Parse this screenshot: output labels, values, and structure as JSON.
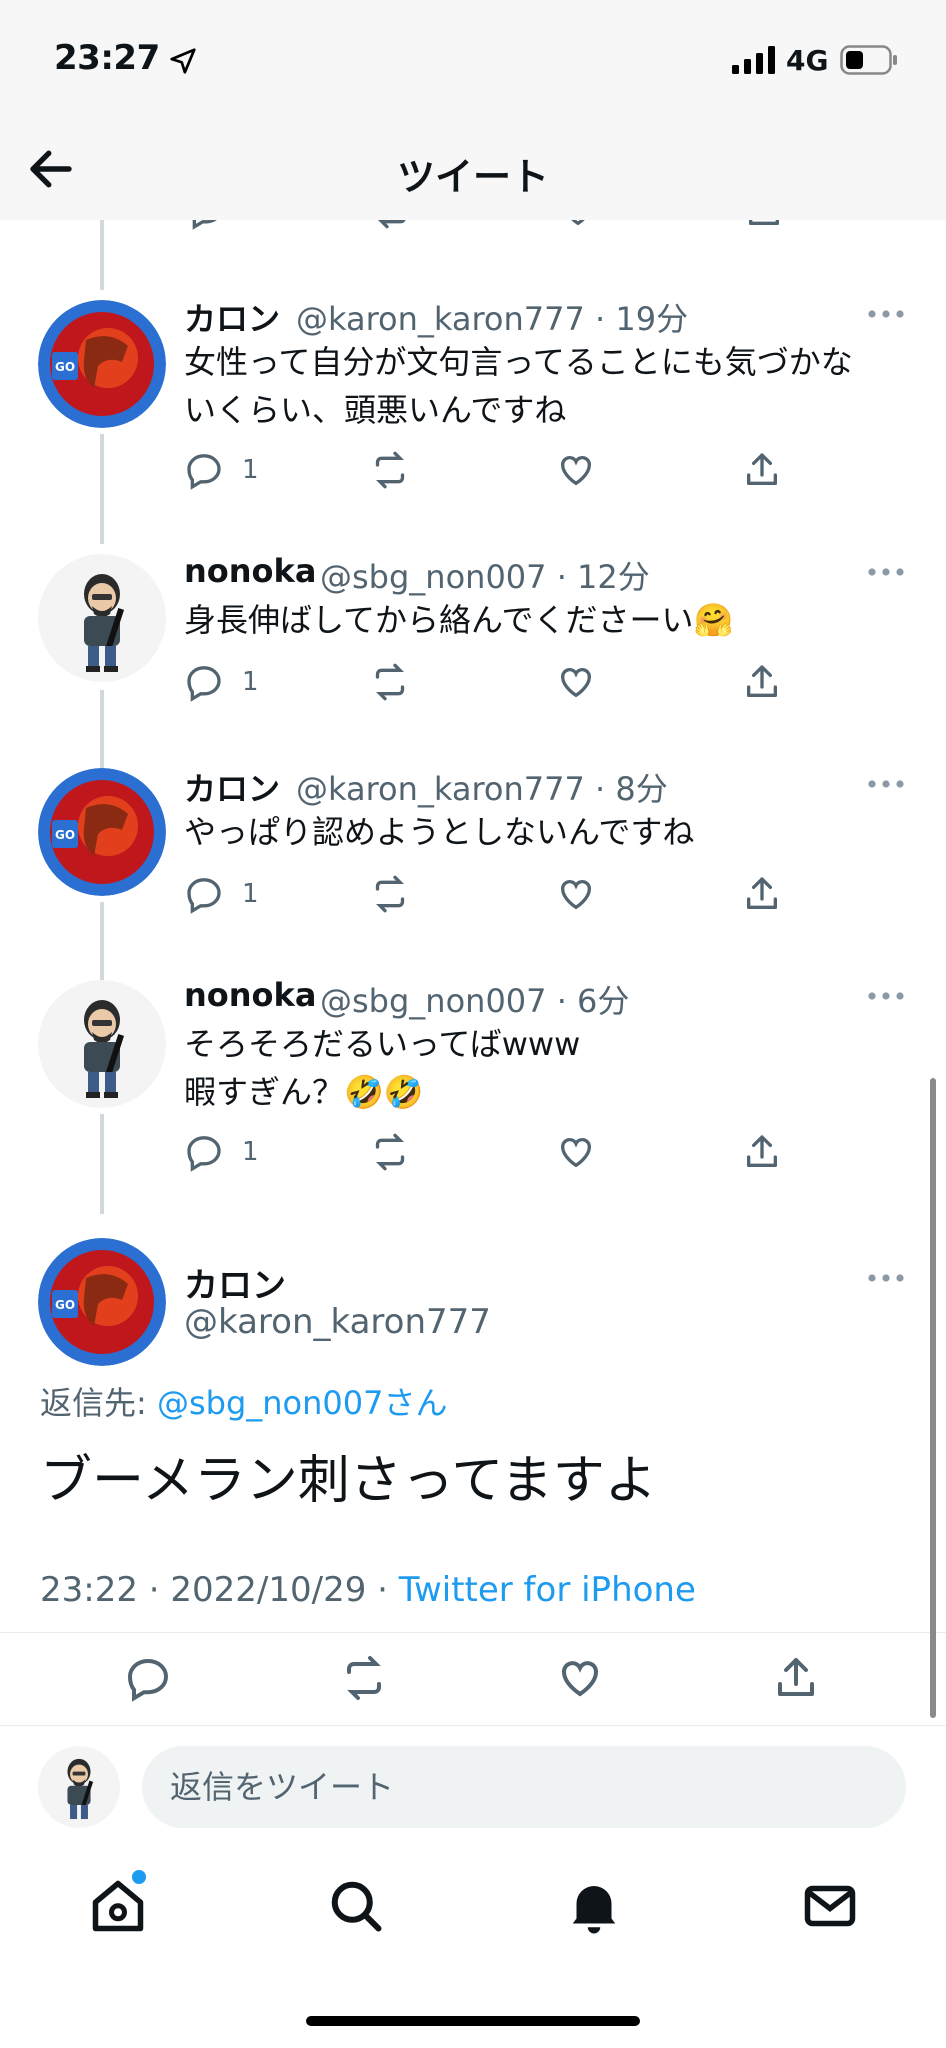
{
  "status_bar": {
    "time": "23:27",
    "network": "4G"
  },
  "header": {
    "title": "ツイート"
  },
  "replies": [
    {
      "name": "カロン",
      "handle": "@karon_karon777",
      "time": "19分",
      "text": "女性って自分が文句言ってることにも気づかな\nいくらい、頭悪いんですね",
      "reply_count": "1"
    },
    {
      "name": "nonoka",
      "handle": "@sbg_non007",
      "time": "12分",
      "text": "身長伸ばしてから絡んでくださーい🤗",
      "reply_count": "1"
    },
    {
      "name": "カロン",
      "handle": "@karon_karon777",
      "time": "8分",
      "text": "やっぱり認めようとしないんですね",
      "reply_count": "1"
    },
    {
      "name": "nonoka",
      "handle": "@sbg_non007",
      "time": "6分",
      "text": "そろそろだるいってばwww\n暇すぎん？🤣🤣",
      "reply_count": "1"
    }
  ],
  "main_tweet": {
    "name": "カロン",
    "handle": "@karon_karon777",
    "reply_to_label": "返信先:",
    "reply_to_handle": "@sbg_non007",
    "reply_to_suffix": "さん",
    "text": "ブーメラン刺さってますよ",
    "timestamp": "23:22 · 2022/10/29 · ",
    "source": "Twitter for iPhone"
  },
  "reply_box": {
    "placeholder": "返信をツイート"
  },
  "tabs": [
    "home-icon",
    "search-icon",
    "notifications-icon",
    "messages-icon"
  ],
  "colors": {
    "accent": "#1d9bf0",
    "secondary_text": "#536471",
    "thread_line": "#cfd9de"
  }
}
